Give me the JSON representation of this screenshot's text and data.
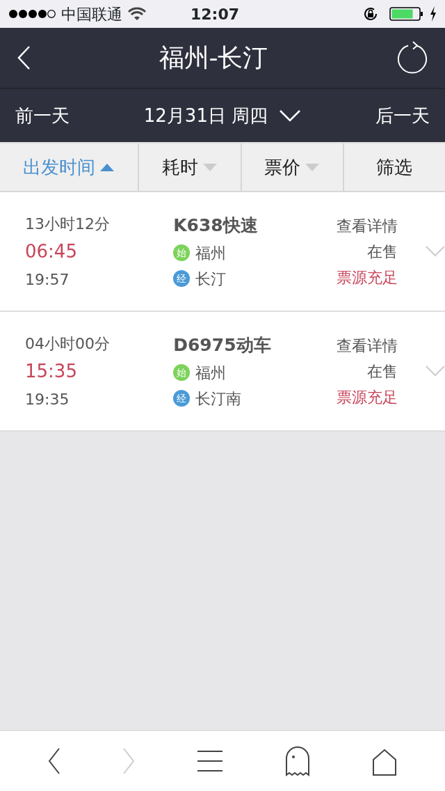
{
  "status_bar": {
    "carrier": "中国联通",
    "time": "12:07"
  },
  "header": {
    "title": "福州-长汀"
  },
  "date_bar": {
    "previous": "前一天",
    "date": "12月31日 周四",
    "next": "后一天"
  },
  "sort_tabs": [
    {
      "label": "出发时间",
      "selected": true,
      "sortable": true
    },
    {
      "label": "耗时",
      "selected": false,
      "sortable": true
    },
    {
      "label": "票价",
      "selected": false,
      "sortable": true
    },
    {
      "label": "筛选",
      "selected": false,
      "sortable": false
    }
  ],
  "trains": [
    {
      "duration": "13小时12分",
      "depart": "06:45",
      "arrive": "19:57",
      "name": "K638快速",
      "from_tag": "始",
      "from": "福州",
      "to_tag": "经",
      "to": "长汀",
      "details": "查看详情",
      "sale": "在售",
      "availability": "票源充足"
    },
    {
      "duration": "04小时00分",
      "depart": "15:35",
      "arrive": "19:35",
      "name": "D6975动车",
      "from_tag": "始",
      "from": "福州",
      "to_tag": "经",
      "to": "长汀南",
      "details": "查看详情",
      "sale": "在售",
      "availability": "票源充足"
    }
  ],
  "toolbar": [
    {
      "kind": "back",
      "disabled": false
    },
    {
      "kind": "forward",
      "disabled": true
    },
    {
      "kind": "menu",
      "disabled": false
    },
    {
      "kind": "ghost",
      "disabled": false
    },
    {
      "kind": "home",
      "disabled": false
    }
  ]
}
